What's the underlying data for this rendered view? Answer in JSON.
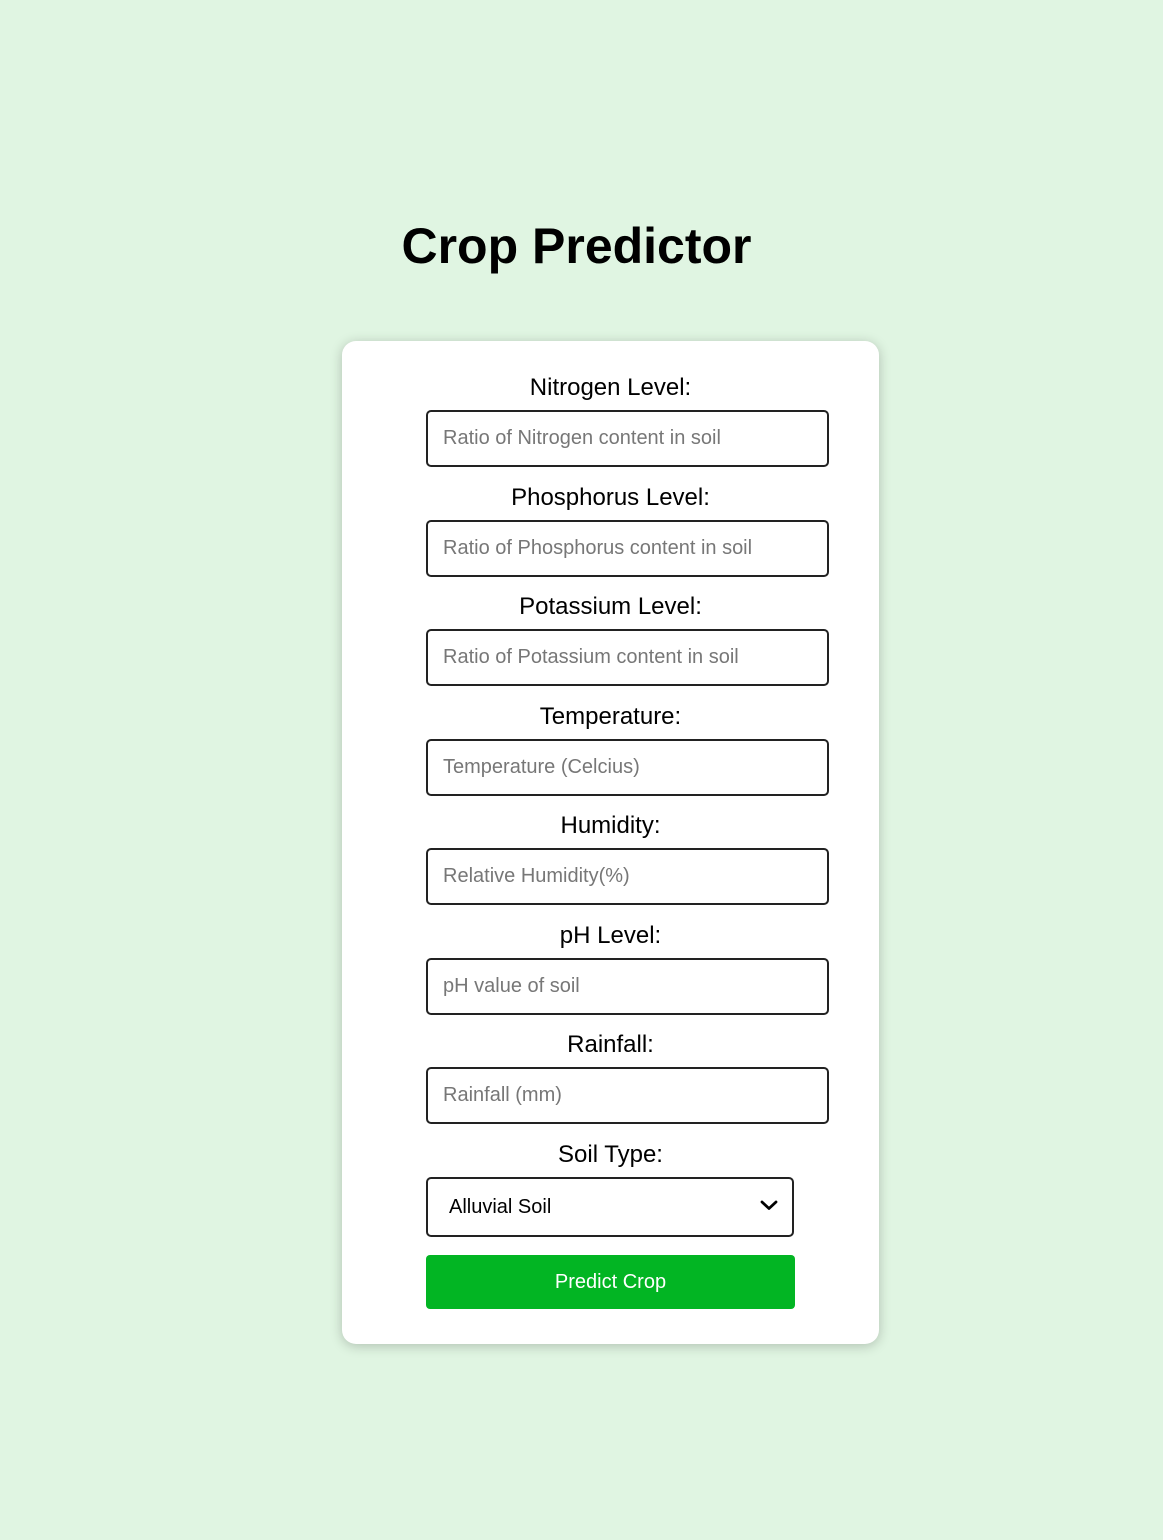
{
  "page": {
    "title": "Crop Predictor"
  },
  "form": {
    "fields": [
      {
        "label": "Nitrogen Level:",
        "placeholder": "Ratio of Nitrogen content in soil",
        "value": ""
      },
      {
        "label": "Phosphorus Level:",
        "placeholder": "Ratio of Phosphorus content in soil",
        "value": ""
      },
      {
        "label": "Potassium Level:",
        "placeholder": "Ratio of Potassium content in soil",
        "value": ""
      },
      {
        "label": "Temperature:",
        "placeholder": "Temperature (Celcius)",
        "value": ""
      },
      {
        "label": "Humidity:",
        "placeholder": "Relative Humidity(%)",
        "value": ""
      },
      {
        "label": "pH Level:",
        "placeholder": "pH value of soil",
        "value": ""
      },
      {
        "label": "Rainfall:",
        "placeholder": "Rainfall (mm)",
        "value": ""
      }
    ],
    "soil": {
      "label": "Soil Type:",
      "selected": "Alluvial Soil"
    },
    "submit_label": "Predict Crop"
  },
  "colors": {
    "background": "#e0f5e2",
    "card": "#ffffff",
    "button": "#02b523",
    "button_text": "#ffffff"
  },
  "icons": {
    "select_arrow": "chevron-down-icon"
  }
}
